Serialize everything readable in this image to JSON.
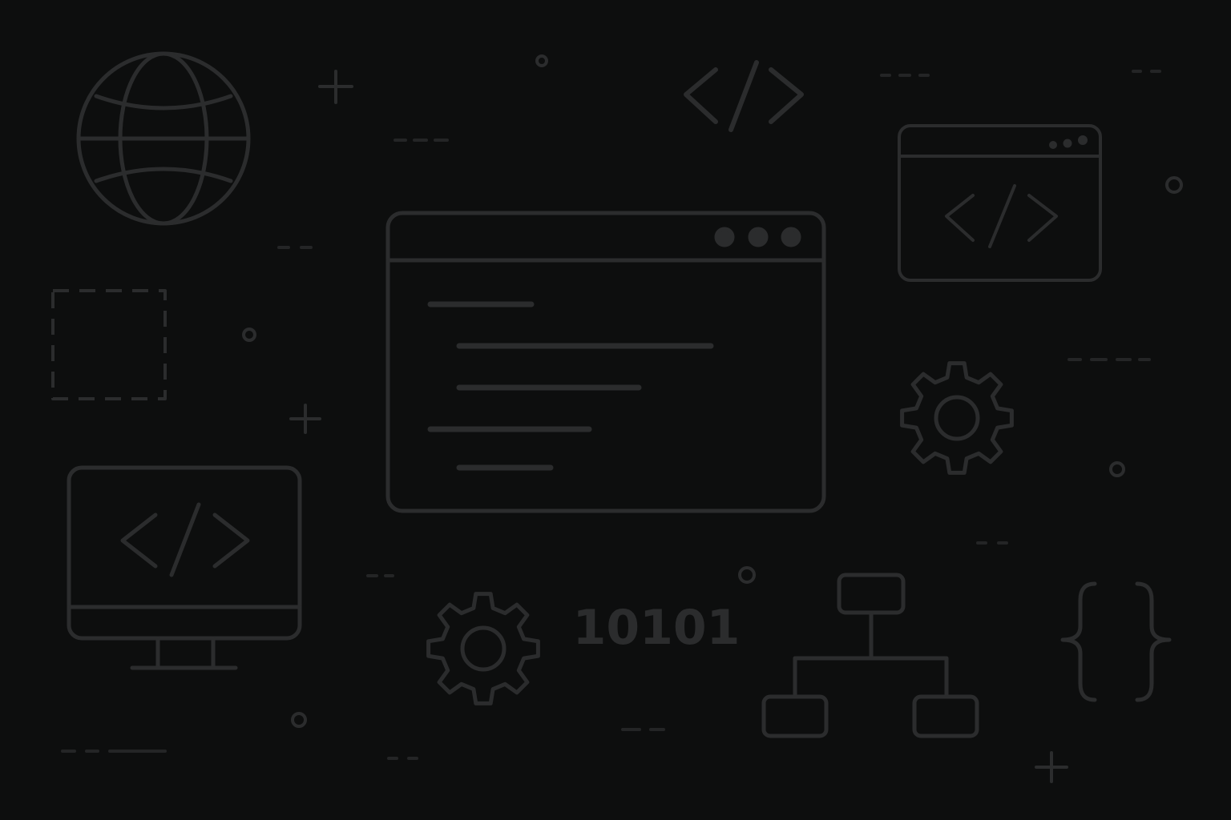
{
  "colors": {
    "background": "#0d0e0e",
    "line": "#2b2c2d",
    "line_soft": "#242526"
  },
  "icons": [
    "globe-icon",
    "code-brackets-icon",
    "code-window-icon",
    "editor-window-icon",
    "selection-box-icon",
    "monitor-code-icon",
    "gear-icon",
    "binary-icon",
    "sitemap-icon",
    "curly-braces-icon",
    "plus-icon",
    "circle-icon",
    "dash-icon"
  ],
  "binary": {
    "text": "10101"
  }
}
